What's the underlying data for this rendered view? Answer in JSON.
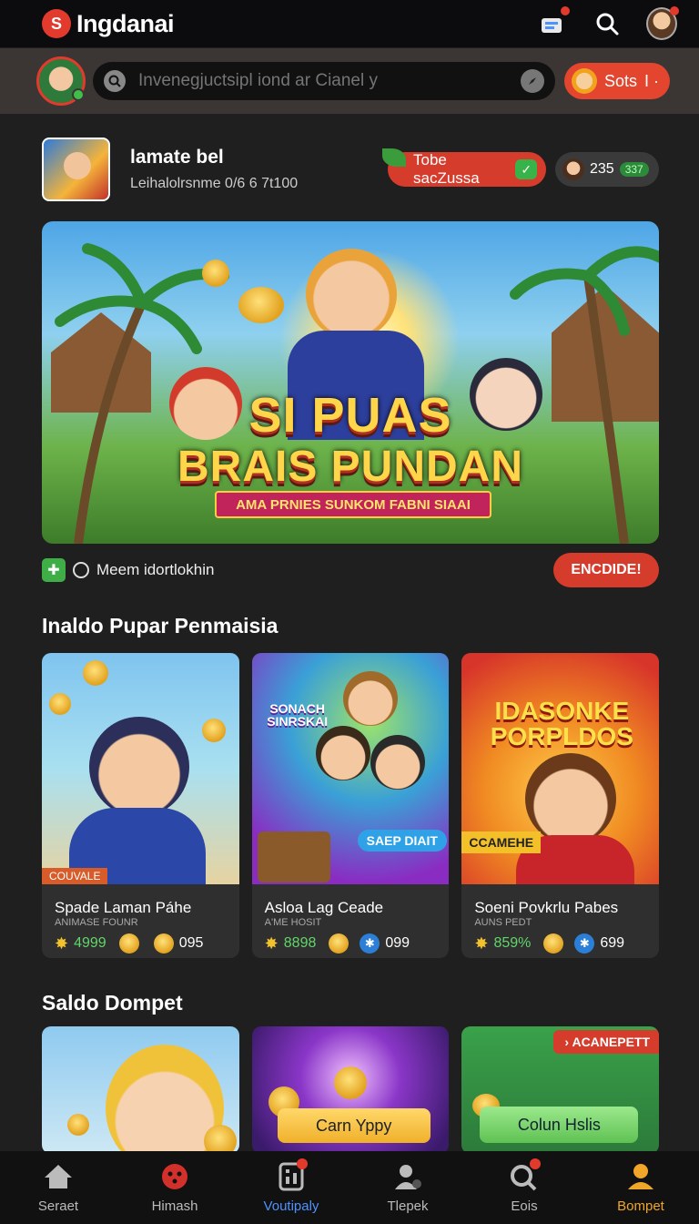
{
  "header": {
    "app_title": "Ingdanai",
    "logo_glyph": "S"
  },
  "search": {
    "placeholder": "Invenegjuctsipl iond ar Cianel y",
    "pill_label": "Sots"
  },
  "profile": {
    "name": "lamate bel",
    "subtitle": "Leihalolrsnme 0/6 6 7t100",
    "action_label": "Tobe sacZussa",
    "coins": "235",
    "coins_badge": "337"
  },
  "hero": {
    "title_line1": "SI PUAS",
    "title_line2": "BRAIS PUNDAN",
    "ribbon": "AMA PRNIES SUNKOM FABNI SIAAI"
  },
  "meta": {
    "label": "Meem idortlokhin",
    "button": "ENCDIDE!"
  },
  "sections": {
    "popular": "Inaldo Pupar Penmaisia",
    "wallet": "Saldo Dompet"
  },
  "cards": [
    {
      "tag": "COUVALE",
      "name": "Spade Laman Páhe",
      "small": "ANIMASE FOUNR",
      "rating": "4999",
      "extra": "095"
    },
    {
      "tag": "SAEP DIAIT",
      "name": "Asloa Lag Ceade",
      "small": "A'ME HOSIT",
      "rating": "8898",
      "extra": "099",
      "art_text": "SONACH SINRSKAI"
    },
    {
      "tag": "CCAMEHE",
      "name": "Soeni Povkrlu Pabes",
      "small": "AUNS PEDT",
      "rating": "859%",
      "extra": "699",
      "art_text": "IDASONKE PORPLDOS"
    }
  ],
  "wallet_cards": [
    {
      "label": ""
    },
    {
      "label": "Carn Yppy"
    },
    {
      "label": "Colun Hslis",
      "badge": "ACANEPETT"
    }
  ],
  "bottom_nav": [
    {
      "label": "Seraet",
      "icon": "home-icon"
    },
    {
      "label": "Himash",
      "icon": "dice-icon"
    },
    {
      "label": "Voutipaly",
      "icon": "calculator-icon"
    },
    {
      "label": "Tlepek",
      "icon": "user-settings-icon"
    },
    {
      "label": "Eois",
      "icon": "search-badge-icon"
    },
    {
      "label": "Bompet",
      "icon": "profile-icon"
    }
  ],
  "colors": {
    "accent_red": "#d63c2c",
    "accent_orange": "#f0a62a",
    "accent_blue": "#4f92ff",
    "success_green": "#3fae46"
  }
}
